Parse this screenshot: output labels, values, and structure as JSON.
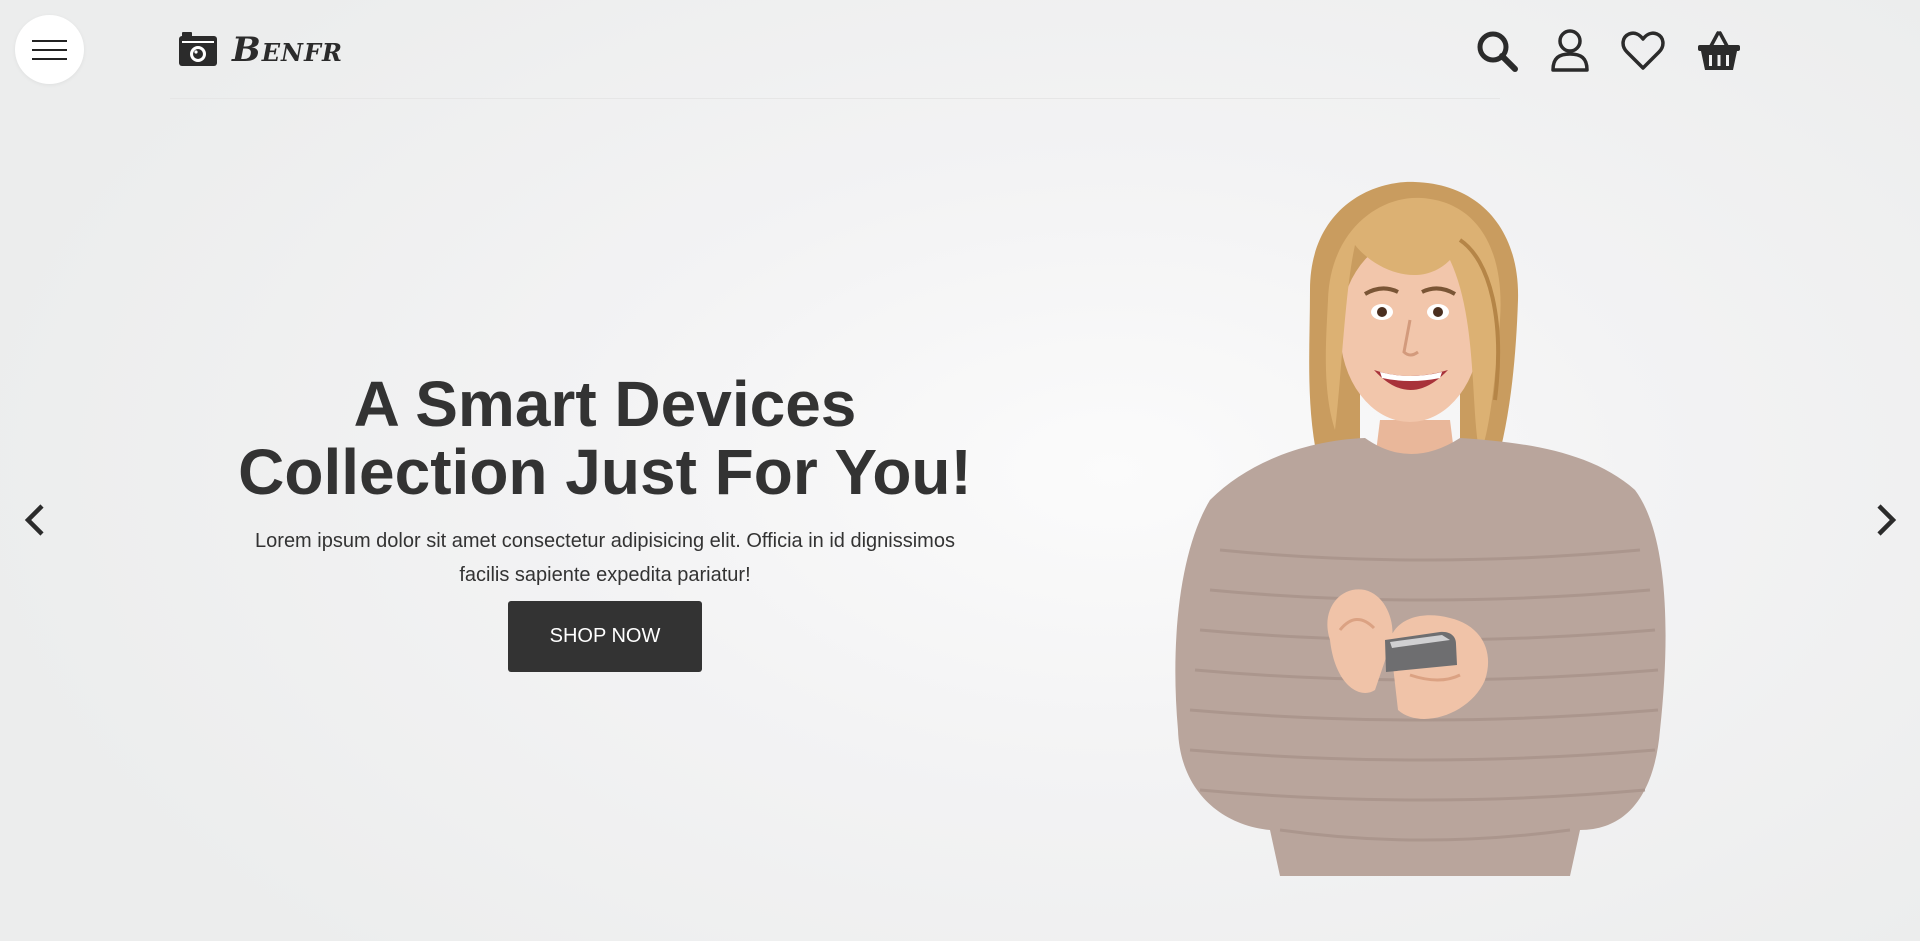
{
  "brand": {
    "name": "Benfr"
  },
  "header": {
    "icons": [
      "search-icon",
      "user-icon",
      "heart-icon",
      "basket-icon"
    ]
  },
  "hero": {
    "title_line1": "A Smart Devices",
    "title_line2": "Collection Just For You!",
    "description_line1": "Lorem ipsum dolor sit amet consectetur adipisicing elit. Officia in id dignissimos",
    "description_line2": "facilis sapiente expedita pariatur!",
    "cta_label": "SHOP NOW"
  },
  "colors": {
    "text": "#333333",
    "button_bg": "#333333",
    "button_text": "#ffffff",
    "sweater": "#b9a59c",
    "hair": "#d5ab6e",
    "skin": "#f0c3a8"
  }
}
